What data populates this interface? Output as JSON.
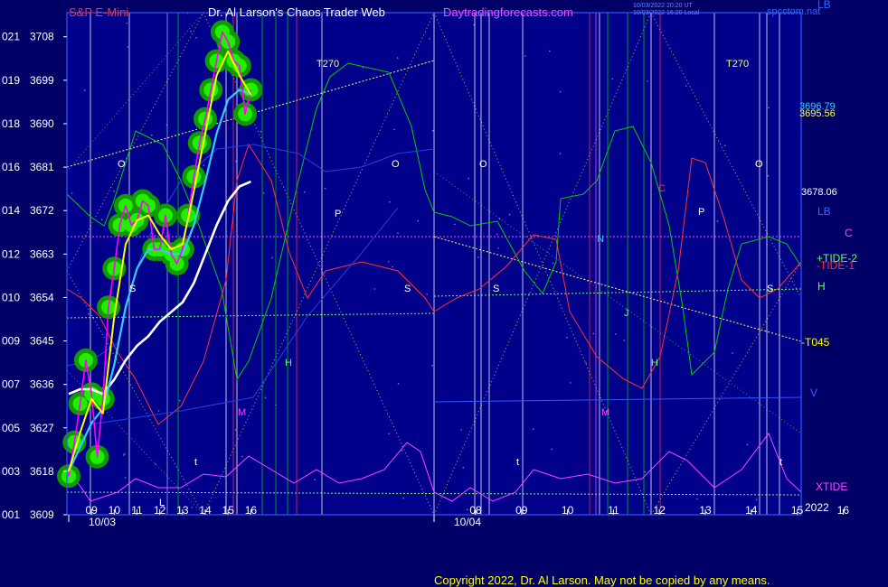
{
  "header": {
    "symbol": "S&P E-Mini",
    "title": "Dr. Al Larson's Chaos Trader Web",
    "site": "Daytradingforecasts.com",
    "ts1": "10/03/2022 20:20 UT",
    "ts2": "10/03/2022 16:20 Local",
    "brand": "spcctom.nat",
    "corner": "LB"
  },
  "footer": {
    "copyright": "Copyright 2022, Dr. Al Larson. May not be copied by any means."
  },
  "colors": {
    "bg": "#000066",
    "plot": "#00008b",
    "price": "#ff00ff",
    "ma_fast": "#ffff00",
    "ma_mid": "#33ccff",
    "ma_slow": "#ffffff",
    "glow": "#22dd00"
  },
  "chart_data": {
    "type": "line",
    "y_ticks": [
      {
        "code": "021",
        "price": "3708"
      },
      {
        "code": "019",
        "price": "3699"
      },
      {
        "code": "018",
        "price": "3690"
      },
      {
        "code": "016",
        "price": "3681"
      },
      {
        "code": "014",
        "price": "3672"
      },
      {
        "code": "012",
        "price": "3663"
      },
      {
        "code": "010",
        "price": "3654"
      },
      {
        "code": "009",
        "price": "3645"
      },
      {
        "code": "007",
        "price": "3636"
      },
      {
        "code": "005",
        "price": "3627"
      },
      {
        "code": "003",
        "price": "3618"
      },
      {
        "code": "001",
        "price": "3609"
      }
    ],
    "ylim": [
      3609,
      3713
    ],
    "xlim": [
      8.0,
      40.1
    ],
    "day1_x_ticks": [
      "09",
      "10",
      "11",
      "12",
      "13",
      "14",
      "15",
      "16"
    ],
    "day2_x_ticks": [
      "08",
      "09",
      "10",
      "11",
      "12",
      "13",
      "14",
      "15",
      "16"
    ],
    "dates": [
      "10/03",
      "10/04"
    ],
    "year": "2022",
    "right_values": [
      {
        "label": "3696.79",
        "value": 3696.79
      },
      {
        "label": "3695.56",
        "value": 3695.56
      },
      {
        "label": "3678.06",
        "value": 3678.06
      }
    ],
    "right_labels": [
      "LB",
      "C",
      "+TIDE-2",
      "-TIDE-1",
      "H",
      "-T045",
      "V",
      "XTIDE"
    ],
    "astro_labels": [
      "T270",
      "T270",
      "O",
      "O",
      "O",
      "O",
      "P",
      "P",
      "S",
      "S",
      "S",
      "S",
      "N",
      "C",
      "J",
      "H",
      "H",
      "M",
      "M",
      "t",
      "t",
      "t",
      "L"
    ],
    "series": [
      {
        "name": "price",
        "x": [
          8.0,
          8.25,
          8.5,
          8.75,
          9.0,
          9.25,
          9.5,
          9.75,
          10.0,
          10.25,
          10.5,
          10.75,
          11.0,
          11.25,
          11.5,
          11.75,
          12.0,
          12.25,
          12.5,
          12.75,
          13.0,
          13.25,
          13.5,
          13.75,
          14.0,
          14.25,
          14.5,
          14.75,
          15.0,
          15.25,
          15.5,
          15.75,
          16.0
        ],
        "values": [
          3617,
          3624,
          3632,
          3641,
          3634,
          3621,
          3633,
          3652,
          3660,
          3669,
          3673,
          3669,
          3670,
          3674,
          3673,
          3664,
          3664,
          3671,
          3663,
          3661,
          3664,
          3671,
          3679,
          3686,
          3691,
          3697,
          3703,
          3709,
          3707,
          3703,
          3702,
          3692,
          3697
        ]
      },
      {
        "name": "ma_fast",
        "x": [
          8.0,
          8.5,
          9.0,
          9.5,
          10.0,
          10.5,
          11.0,
          11.5,
          12.0,
          12.5,
          13.0,
          13.5,
          14.0,
          14.5,
          15.0,
          15.5,
          16.0
        ],
        "values": [
          3618,
          3626,
          3633,
          3630,
          3650,
          3665,
          3670,
          3671,
          3667,
          3664,
          3665,
          3676,
          3688,
          3700,
          3705,
          3700,
          3696
        ]
      },
      {
        "name": "ma_mid",
        "x": [
          8.0,
          8.5,
          9.0,
          9.5,
          10.0,
          10.5,
          11.0,
          11.5,
          12.0,
          12.5,
          13.0,
          13.5,
          14.0,
          14.5,
          15.0,
          15.5,
          16.0
        ],
        "values": [
          3618,
          3623,
          3628,
          3631,
          3640,
          3652,
          3660,
          3664,
          3664,
          3663,
          3663,
          3669,
          3678,
          3688,
          3695,
          3697,
          3696
        ]
      },
      {
        "name": "ma_slow",
        "x": [
          8.0,
          8.5,
          9.0,
          9.5,
          10.0,
          10.5,
          11.0,
          11.5,
          12.0,
          12.5,
          13.0,
          13.5,
          14.0,
          14.5,
          15.0,
          15.5,
          16.0
        ],
        "values": [
          3634,
          3635,
          3635,
          3634,
          3637,
          3641,
          3644,
          3646,
          3649,
          3651,
          3653,
          3657,
          3663,
          3669,
          3674,
          3677,
          3678
        ]
      }
    ]
  }
}
